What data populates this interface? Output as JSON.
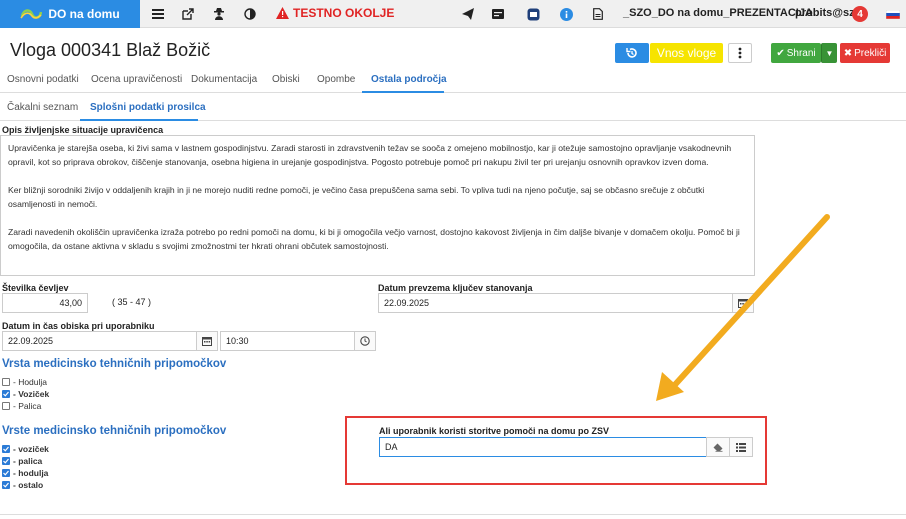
{
  "topbar": {
    "brand": "DO na domu",
    "test_warning": "TESTNO OKOLJE",
    "presentation": "_SZO_DO na domu_PREZENTACIJA",
    "user": "probits@szo",
    "notification_count": "4",
    "icons": [
      "list-icon",
      "external-link-icon",
      "user-secret-icon",
      "contrast-icon",
      "send-icon",
      "card-icon",
      "inbox-icon",
      "info-icon",
      "document-icon",
      "flag-icon"
    ]
  },
  "header": {
    "title": "Vloga 000341 Blaž Božič",
    "submit_label": "Vnos vloge",
    "save_label": "Shrani",
    "cancel_label": "Prekliči"
  },
  "tabs": [
    {
      "label": "Osnovni podatki"
    },
    {
      "label": "Ocena upravičenosti"
    },
    {
      "label": "Dokumentacija"
    },
    {
      "label": "Obiski"
    },
    {
      "label": "Opombe"
    },
    {
      "label": "Ostala področja",
      "active": true
    }
  ],
  "subtabs": [
    {
      "label": "Čakalni seznam"
    },
    {
      "label": "Splošni podatki prosilca",
      "active": true
    }
  ],
  "situation": {
    "label": "Opis življenjske situacije upravičenca",
    "paragraphs": [
      "Upravičenka je starejša oseba, ki živi sama v lastnem gospodinjstvu. Zaradi starosti in zdravstvenih težav se sooča z omejeno mobilnostjo, kar ji otežuje samostojno opravljanje vsakodnevnih opravil, kot so priprava obrokov, čiščenje stanovanja, osebna higiena in urejanje gospodinjstva. Pogosto potrebuje pomoč pri nakupu živil ter pri urejanju osnovnih opravkov izven doma.",
      "Ker bližnji sorodniki živijo v oddaljenih krajih in ji ne morejo nuditi redne pomoči, je večino časa prepuščena sama sebi. To vpliva tudi na njeno počutje, saj se občasno srečuje z občutki osamljenosti in nemoči.",
      "Zaradi navedenih okoliščin upravičenka izraža potrebo po redni pomoči na domu, ki bi ji omogočila večjo varnost, dostojno kakovost življenja in čim daljše bivanje v domačem okolju. Pomoč bi ji omogočila, da ostane aktivna v skladu s svojimi zmožnostmi ter hkrati ohrani občutek samostojnosti."
    ]
  },
  "fields": {
    "shoe_label": "Številka čevljev",
    "shoe_value": "43,00",
    "shoe_range": "( 35 - 47 )",
    "keys_label": "Datum prevzema ključev stanovanja",
    "keys_value": "22.09.2025",
    "visit_label": "Datum in čas obiska pri uporabniku",
    "visit_date": "22.09.2025",
    "visit_time": "10:30",
    "zsv_label": "Ali uporabnik koristi storitve pomoči na domu po ZSV",
    "zsv_value": "DA"
  },
  "aids": {
    "title": "Vrsta medicinsko tehničnih pripomočkov",
    "items": [
      {
        "label": "- Hodulja",
        "checked": false
      },
      {
        "label": "- Voziček",
        "checked": true
      },
      {
        "label": "- Palica",
        "checked": false
      }
    ]
  },
  "aids2": {
    "title": "Vrste medicinsko tehničnih pripomočkov",
    "items": [
      {
        "label": "- voziček",
        "checked": true
      },
      {
        "label": "- palica",
        "checked": true
      },
      {
        "label": "- hodulja",
        "checked": true
      },
      {
        "label": "- ostalo",
        "checked": true
      }
    ]
  },
  "colors": {
    "brand": "#2b8ce3",
    "accent_yellow": "#f6e400",
    "save_green": "#41a73f",
    "cancel_red": "#e53935",
    "annotation_arrow": "#f2ab1f",
    "highlight_border": "#e53935"
  }
}
